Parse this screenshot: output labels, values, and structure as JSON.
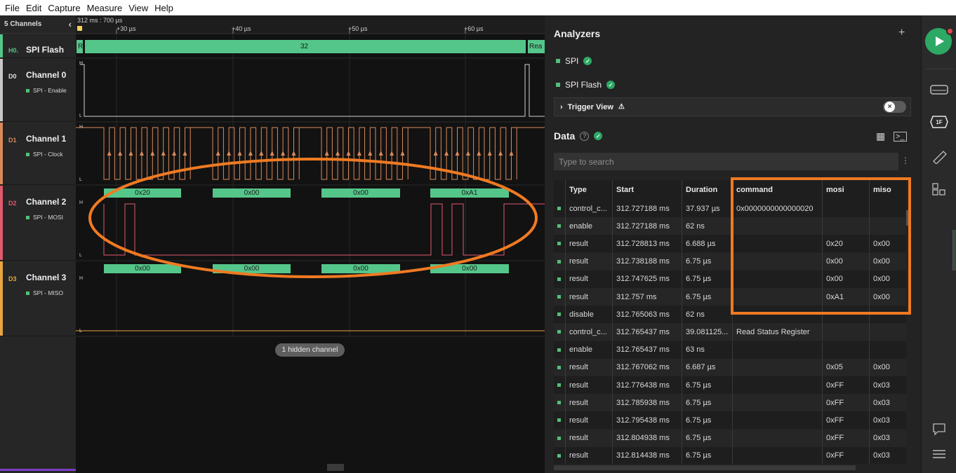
{
  "menu": {
    "items": [
      "File",
      "Edit",
      "Capture",
      "Measure",
      "View",
      "Help"
    ]
  },
  "channels": {
    "header": "5 Channels",
    "rows": [
      {
        "tag": "H0.",
        "name": "SPI Flash",
        "sub": "",
        "color": "#55c68a"
      },
      {
        "tag": "D0",
        "name": "Channel 0",
        "sub": "SPI - Enable",
        "color": "#c8c8c8"
      },
      {
        "tag": "D1",
        "name": "Channel 1",
        "sub": "SPI - Clock",
        "color": "#d9895a"
      },
      {
        "tag": "D2",
        "name": "Channel 2",
        "sub": "SPI - MOSI",
        "color": "#e05a6e"
      },
      {
        "tag": "D3",
        "name": "Channel 3",
        "sub": "SPI - MISO",
        "color": "#e8a640"
      }
    ]
  },
  "waveform": {
    "ruler_label": "312 ms : 700 µs",
    "ticks": [
      "+30 µs",
      "+40 µs",
      "+50 µs",
      "+60 µs"
    ],
    "flash_packets": [
      "R",
      "32",
      "Rea"
    ],
    "mosi_packets": [
      "0x20",
      "0x00",
      "0x00",
      "0xA1"
    ],
    "miso_packets": [
      "0x00",
      "0x00",
      "0x00",
      "0x00"
    ],
    "hidden_label": "1 hidden channel",
    "level_high": "H",
    "level_low": "L"
  },
  "panel": {
    "analyzers_title": "Analyzers",
    "analyzers": [
      "SPI",
      "SPI Flash"
    ],
    "trigger_view": "Trigger View",
    "data_title": "Data",
    "search_placeholder": "Type to search",
    "columns": [
      "Type",
      "Start",
      "Duration",
      "command",
      "mosi",
      "miso"
    ],
    "rows": [
      {
        "type": "control_c...",
        "start": "312.727188 ms",
        "duration": "37.937 µs",
        "command": "0x0000000000000020",
        "mosi": "",
        "miso": ""
      },
      {
        "type": "enable",
        "start": "312.727188 ms",
        "duration": "62 ns",
        "command": "",
        "mosi": "",
        "miso": ""
      },
      {
        "type": "result",
        "start": "312.728813 ms",
        "duration": "6.688 µs",
        "command": "",
        "mosi": "0x20",
        "miso": "0x00"
      },
      {
        "type": "result",
        "start": "312.738188 ms",
        "duration": "6.75 µs",
        "command": "",
        "mosi": "0x00",
        "miso": "0x00"
      },
      {
        "type": "result",
        "start": "312.747625 ms",
        "duration": "6.75 µs",
        "command": "",
        "mosi": "0x00",
        "miso": "0x00"
      },
      {
        "type": "result",
        "start": "312.757 ms",
        "duration": "6.75 µs",
        "command": "",
        "mosi": "0xA1",
        "miso": "0x00"
      },
      {
        "type": "disable",
        "start": "312.765063 ms",
        "duration": "62 ns",
        "command": "",
        "mosi": "",
        "miso": ""
      },
      {
        "type": "control_c...",
        "start": "312.765437 ms",
        "duration": "39.081125...",
        "command": "Read Status Register",
        "mosi": "",
        "miso": ""
      },
      {
        "type": "enable",
        "start": "312.765437 ms",
        "duration": "63 ns",
        "command": "",
        "mosi": "",
        "miso": ""
      },
      {
        "type": "result",
        "start": "312.767062 ms",
        "duration": "6.687 µs",
        "command": "",
        "mosi": "0x05",
        "miso": "0x00"
      },
      {
        "type": "result",
        "start": "312.776438 ms",
        "duration": "6.75 µs",
        "command": "",
        "mosi": "0xFF",
        "miso": "0x03"
      },
      {
        "type": "result",
        "start": "312.785938 ms",
        "duration": "6.75 µs",
        "command": "",
        "mosi": "0xFF",
        "miso": "0x03"
      },
      {
        "type": "result",
        "start": "312.795438 ms",
        "duration": "6.75 µs",
        "command": "",
        "mosi": "0xFF",
        "miso": "0x03"
      },
      {
        "type": "result",
        "start": "312.804938 ms",
        "duration": "6.75 µs",
        "command": "",
        "mosi": "0xFF",
        "miso": "0x03"
      },
      {
        "type": "result",
        "start": "312.814438 ms",
        "duration": "6.75 µs",
        "command": "",
        "mosi": "0xFF",
        "miso": "0x03"
      }
    ]
  },
  "sidebar": {
    "badge": "1F"
  },
  "colors": {
    "accent": "#2ea865",
    "annotation": "#f07a22",
    "packet": "#55c68a"
  }
}
